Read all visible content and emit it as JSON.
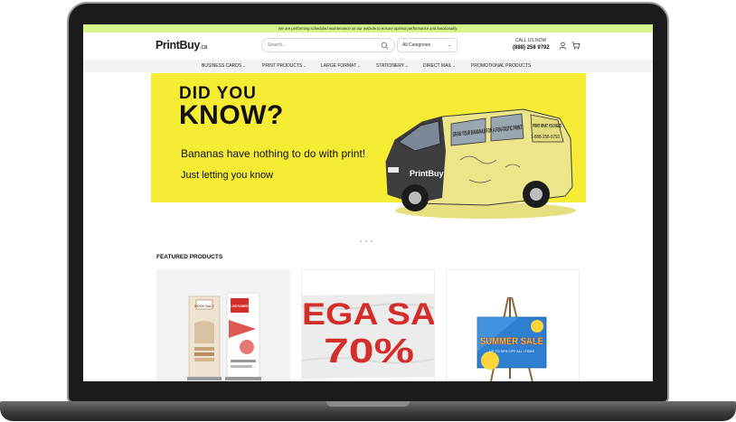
{
  "maintenance": {
    "text": "We are performing scheduled maintenance on our website to ensure optimal performance and functionality."
  },
  "header": {
    "logo_main": "PrintBuy",
    "logo_suffix": ".ca",
    "search_placeholder": "Search...",
    "search_icon": "search-icon",
    "category_selected": "All Categories",
    "call_label": "CALL US NOW",
    "call_number": "(888) 258 9792",
    "user_icon": "user-icon",
    "cart_icon": "cart-icon"
  },
  "nav": {
    "items": [
      {
        "label": "BUSINESS CARDS",
        "has_dropdown": true
      },
      {
        "label": "PRINT PRODUCTS",
        "has_dropdown": true
      },
      {
        "label": "LARGE FORMAT",
        "has_dropdown": true
      },
      {
        "label": "STATIONERY",
        "has_dropdown": true
      },
      {
        "label": "DIRECT MAIL",
        "has_dropdown": true
      },
      {
        "label": "PROMOTIONAL PRODUCTS",
        "has_dropdown": false
      }
    ]
  },
  "hero": {
    "title_line1": "DID YOU",
    "title_line2": "KNOW?",
    "line1": "Bananas have nothing to do with print!",
    "line2": "Just letting you know",
    "van_brand": "PrintBuy",
    "van_text1": "GRAB YOUR BANANAS FOR A FUN-TASTIC PRINT!",
    "van_text2": "PRINT WHAT YOU NEED",
    "van_phone": "1-888-258-9792",
    "bg_color": "#f6ec34"
  },
  "carousel": {
    "dot_count": 3
  },
  "featured": {
    "title": "FEATURED PRODUCTS",
    "products": [
      {
        "name": "roll-up-banners",
        "banner1_text": "BOOK SALE",
        "banner2_text": "LOVE FLOWERS"
      },
      {
        "name": "vinyl-banner",
        "line1": "EGA SA",
        "line2": "70%"
      },
      {
        "name": "foam-board-sign",
        "text1": "SUMMER SALE",
        "text2": "UP TO 50% OFF ALL ITEMS"
      }
    ]
  },
  "colors": {
    "maintenance_bg": "#d4f58a",
    "accent_red": "#d42e2a",
    "nav_bg": "#f2f2f2"
  }
}
